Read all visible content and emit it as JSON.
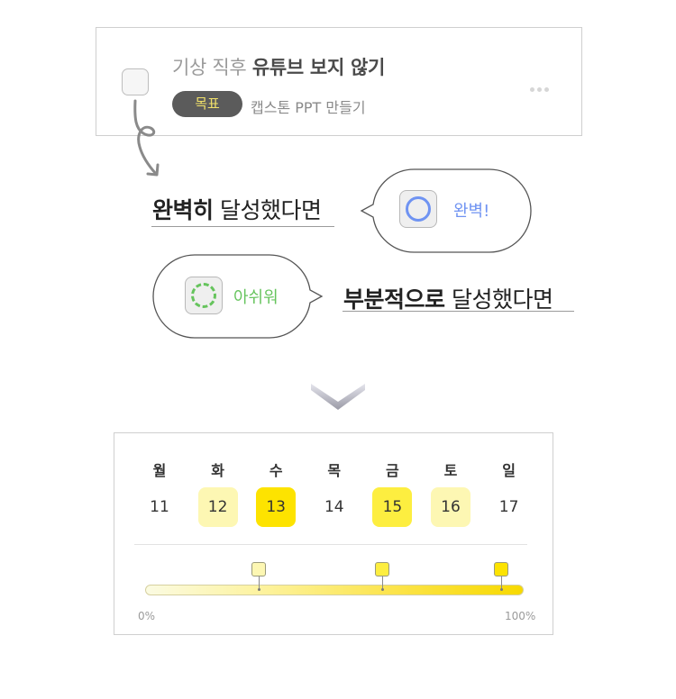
{
  "task": {
    "title_prefix": "기상 직후",
    "title_bold": "유튜브 보지 않기",
    "badge": "목표",
    "goal": "캡스톤 PPT 만들기",
    "more_icon": "more-dots-icon"
  },
  "perfect": {
    "bold": "완벽히",
    "rest": "달성했다면",
    "bubble_label": "완벽!",
    "color": "#6f93f2"
  },
  "partial": {
    "bold": "부분적으로",
    "rest": "달성했다면",
    "bubble_label": "아쉬워",
    "color": "#66c45d"
  },
  "calendar": {
    "days": [
      {
        "name": "월",
        "date": "11",
        "level": "none"
      },
      {
        "name": "화",
        "date": "12",
        "level": "light"
      },
      {
        "name": "수",
        "date": "13",
        "level": "full"
      },
      {
        "name": "목",
        "date": "14",
        "level": "none"
      },
      {
        "name": "금",
        "date": "15",
        "level": "strong"
      },
      {
        "name": "토",
        "date": "16",
        "level": "light"
      },
      {
        "name": "일",
        "date": "17",
        "level": "none"
      }
    ],
    "colors": {
      "light": "#fdf7b3",
      "strong": "#fdee40",
      "full": "#fde300"
    },
    "progress": {
      "start_label": "0%",
      "end_label": "100%",
      "markers": [
        {
          "level": "light",
          "fraction": 0.3
        },
        {
          "level": "strong",
          "fraction": 0.625
        },
        {
          "level": "full",
          "fraction": 0.94
        }
      ]
    }
  }
}
